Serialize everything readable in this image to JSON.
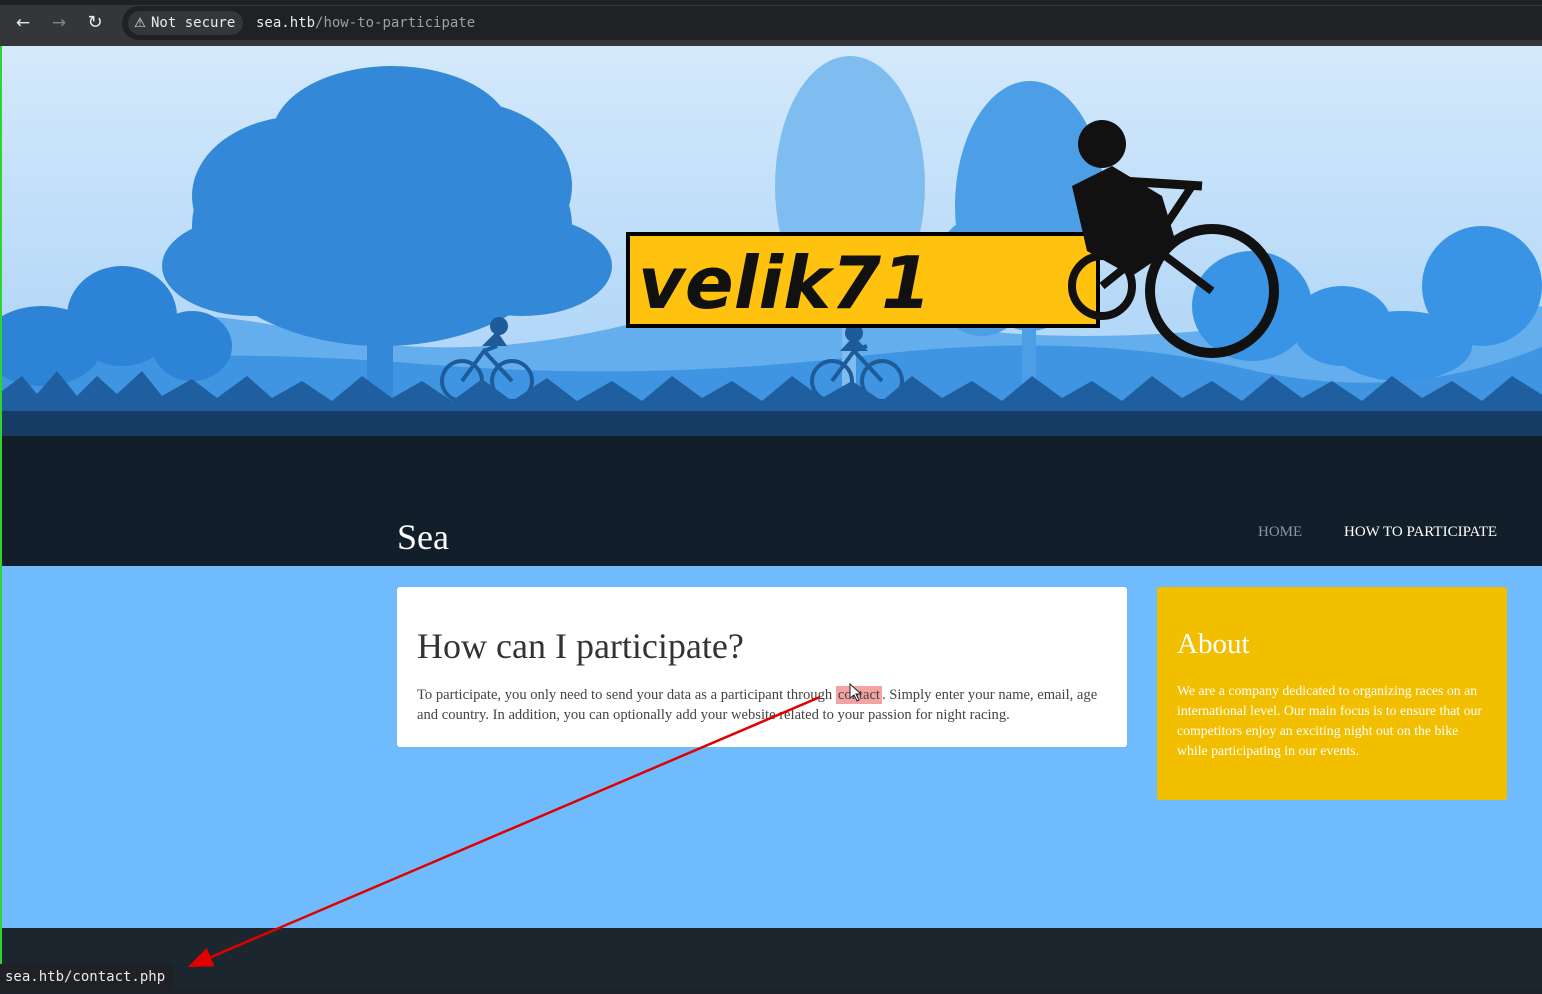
{
  "browser": {
    "security_label": "Not secure",
    "url_host": "sea.htb",
    "url_path": "/how-to-participate",
    "status_url": "sea.htb/contact.php",
    "icons": {
      "back": "arrow-left-icon",
      "forward": "arrow-right-icon",
      "reload": "reload-icon",
      "security": "warning-triangle-icon"
    }
  },
  "hero": {
    "logo_text": "velik71"
  },
  "site": {
    "title": "Sea",
    "nav": [
      {
        "label": "HOME"
      },
      {
        "label": "HOW TO PARTICIPATE"
      }
    ]
  },
  "main": {
    "heading": "How can I participate?",
    "text_before": "To participate, you only need to send your data as a participant through ",
    "link_text": "contact",
    "text_after": ". Simply enter your name, email, age and country. In addition, you can optionally add your website related to your passion for night racing."
  },
  "about": {
    "heading": "About",
    "text": "We are a company dedicated to organizing races on an international level. Our main focus is to ensure that our competitors enjoy an exciting night out on the bike while participating in our events."
  },
  "colors": {
    "page_bg": "#70bbfd",
    "about_bg": "#f2be00",
    "hero_dark": "#131e2b",
    "logo_yellow": "#ffc20e",
    "annotation_red": "#e00000"
  }
}
